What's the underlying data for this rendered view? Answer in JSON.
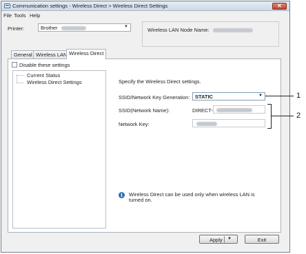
{
  "window": {
    "title": "Communication settings - Wireless Direct > Wireless Direct Settings",
    "close_glyph": "✕"
  },
  "menu": [
    "File",
    "Tools",
    "Help"
  ],
  "printer": {
    "label": "Printer:",
    "value": "Brother",
    "node_name_label": "Wireless LAN Node Name:"
  },
  "tabs": [
    {
      "label": "General",
      "active": false
    },
    {
      "label": "Wireless LAN",
      "active": false
    },
    {
      "label": "Wireless Direct",
      "active": true
    }
  ],
  "disable_label": "Disable these settings",
  "tree": [
    "Current Status",
    "Wireless Direct Settings"
  ],
  "panel": {
    "heading": "Specify the Wireless Direct settings.",
    "ssid_gen_label": "SSID/Network Key Generation:",
    "ssid_gen_value": "STATIC",
    "ssid_name_label": "SSID(Network Name):",
    "ssid_prefix": "DIRECT-",
    "network_key_label": "Network Key:"
  },
  "info_text": "Wireless Direct can be used only when wireless LAN is turned on.",
  "buttons": {
    "apply": "Apply",
    "exit": "Exit"
  },
  "callouts": [
    "1",
    "2"
  ],
  "colors": {
    "info_icon": "#2f6db5",
    "close_button": "#c0402c"
  }
}
